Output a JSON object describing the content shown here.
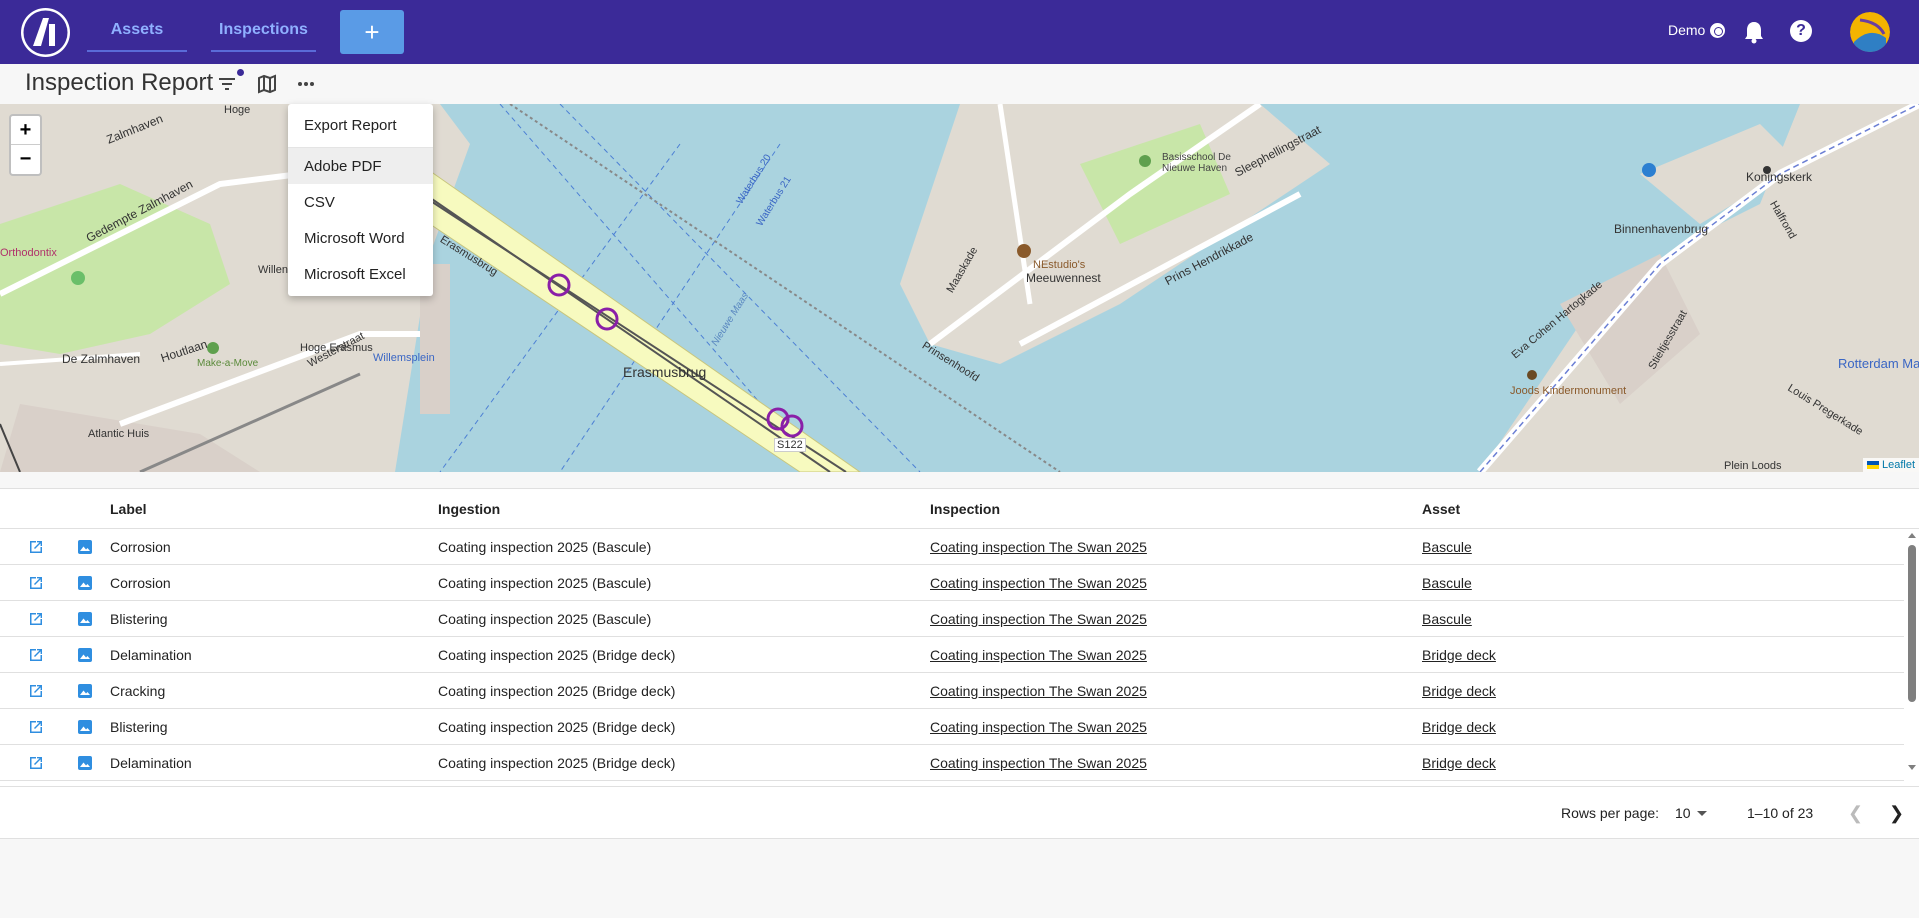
{
  "nav": {
    "logo_alt": "logo",
    "tabs": [
      {
        "label": "Assets"
      },
      {
        "label": "Inspections"
      }
    ],
    "add_label": "+",
    "user": "Demo"
  },
  "page": {
    "title": "Inspection Report"
  },
  "map": {
    "zoom_in": "+",
    "zoom_out": "−",
    "attribution": "Leaflet",
    "labels": {
      "zalmhaven": "Zalmhaven",
      "gedempte": "Gedempte Zalmhaven",
      "dezalmhaven": "De Zalmhaven",
      "houtlaan": "Houtlaan",
      "erasmusbrug": "Erasmusbrug",
      "erasmusbrug_road": "Erasmusbrug",
      "westerstraat": "Westerstraat",
      "willemsplein": "Willemsplein",
      "meeuwennest": "Meeuwennest",
      "nestudio": "NEstudio's",
      "prinsenhoofd": "Prinsenhoofd",
      "prinshendrikkade": "Prins Hendrikkade",
      "sleephelling": "Sleephellingstraat",
      "binnenhavenbrug": "Binnenhavenbrug",
      "koningskerk": "Koningskerk",
      "rotterdam_marina": "Rotterdam Marina",
      "joods": "Joods Kindermonument",
      "eva": "Eva Cohen Hartogkade",
      "plein_loods": "Plein Loods",
      "louis": "Louis Pregerkade",
      "orthodontix": "Orthodontix",
      "hoge": "Hoge",
      "hoge_erasmus": "Hoge Erasmus",
      "willen": "Willen",
      "atlantic": "Atlantic Huis",
      "make_a_move": "Make-a-Move",
      "maaskade": "Maaskade",
      "stieltjesstraat": "Stieltjesstraat",
      "halfrond": "Halfrond",
      "s122": "S122",
      "nieuwe_maas": "Nieuwe Maas",
      "waterbus20": "Waterbus 20",
      "waterbus21": "Waterbus 21",
      "basisschool": "Basisschool De Nieuwe Haven"
    }
  },
  "export_menu": {
    "header": "Export Report",
    "items": [
      {
        "label": "Adobe PDF"
      },
      {
        "label": "CSV"
      },
      {
        "label": "Microsoft Word"
      },
      {
        "label": "Microsoft Excel"
      }
    ]
  },
  "table": {
    "columns": [
      "Label",
      "Ingestion",
      "Inspection",
      "Asset"
    ],
    "rows": [
      {
        "label": "Corrosion",
        "ingestion": "Coating inspection 2025 (Bascule)",
        "inspection": "Coating inspection The Swan 2025",
        "asset": "Bascule"
      },
      {
        "label": "Corrosion",
        "ingestion": "Coating inspection 2025 (Bascule)",
        "inspection": "Coating inspection The Swan 2025",
        "asset": "Bascule"
      },
      {
        "label": "Blistering",
        "ingestion": "Coating inspection 2025 (Bascule)",
        "inspection": "Coating inspection The Swan 2025",
        "asset": "Bascule"
      },
      {
        "label": "Delamination",
        "ingestion": "Coating inspection 2025 (Bridge deck)",
        "inspection": "Coating inspection The Swan 2025",
        "asset": "Bridge deck"
      },
      {
        "label": "Cracking",
        "ingestion": "Coating inspection 2025 (Bridge deck)",
        "inspection": "Coating inspection The Swan 2025",
        "asset": "Bridge deck"
      },
      {
        "label": "Blistering",
        "ingestion": "Coating inspection 2025 (Bridge deck)",
        "inspection": "Coating inspection The Swan 2025",
        "asset": "Bridge deck"
      },
      {
        "label": "Delamination",
        "ingestion": "Coating inspection 2025 (Bridge deck)",
        "inspection": "Coating inspection The Swan 2025",
        "asset": "Bridge deck"
      }
    ]
  },
  "pagination": {
    "rows_per_page_label": "Rows per page:",
    "rows_per_page": "10",
    "range": "1–10 of 23"
  },
  "colors": {
    "topbar": "#3b2a98",
    "accent": "#5a9be6",
    "marker": "#8a1fa8"
  }
}
